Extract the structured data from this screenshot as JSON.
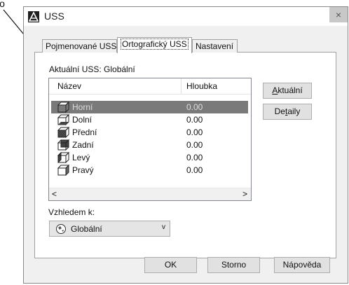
{
  "annotation": {
    "label": "ĺo"
  },
  "window": {
    "title": "USS",
    "close_glyph": "×"
  },
  "tabs": [
    {
      "label": "Pojmenované USS"
    },
    {
      "label": "Ortografický USS"
    },
    {
      "label": "Nastavení"
    }
  ],
  "current_ucs": "Aktuální USS: Globální",
  "list": {
    "columns": {
      "name": "Název",
      "depth": "Hloubka"
    },
    "rows": [
      {
        "name": "Horní",
        "depth": "0.00",
        "selected": true
      },
      {
        "name": "Dolní",
        "depth": "0.00"
      },
      {
        "name": "Přední",
        "depth": "0.00"
      },
      {
        "name": "Zadní",
        "depth": "0.00"
      },
      {
        "name": "Levý",
        "depth": "0.00"
      },
      {
        "name": "Pravý",
        "depth": "0.00"
      }
    ],
    "scroll_left": "<",
    "scroll_right": ">"
  },
  "side_buttons": {
    "current": {
      "prefix": "",
      "ul": "A",
      "rest": "ktuální"
    },
    "details": {
      "prefix": "De",
      "ul": "t",
      "rest": "aily"
    }
  },
  "relative_to": {
    "label": "Vzhledem k:",
    "value": "Globální",
    "chevron": "v"
  },
  "footer": {
    "ok": "OK",
    "cancel": "Storno",
    "help": "Nápověda"
  },
  "colors": {
    "selection": "#7a7a7a",
    "dialog_bg": "#f0f0f0",
    "button_bg": "#e1e1e1"
  }
}
